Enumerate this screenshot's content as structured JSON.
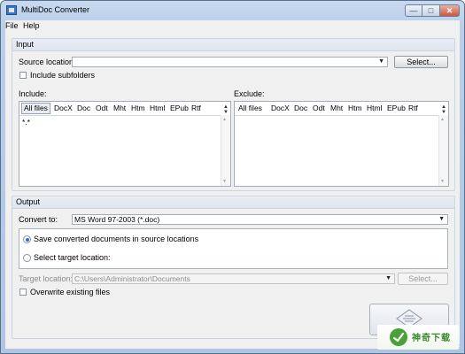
{
  "window": {
    "title": "MultiDoc Converter"
  },
  "menu": [
    "File",
    "Help"
  ],
  "input": {
    "group_title": "Input",
    "source_label": "Source location:",
    "source_value": "",
    "select_button": "Select...",
    "include_subfolders_label": "Include subfolders",
    "include_subfolders_checked": false,
    "include_label": "Include:",
    "exclude_label": "Exclude:",
    "file_types": [
      "All files",
      "DocX",
      "Doc",
      "Odt",
      "Mht",
      "Htm",
      "Html",
      "EPub",
      "Rtf"
    ],
    "include_entries": [
      "*.*"
    ],
    "exclude_entries": []
  },
  "output": {
    "group_title": "Output",
    "convert_to_label": "Convert to:",
    "convert_to_value": "MS Word 97-2003 (*.doc)",
    "save_in_source_label": "Save converted documents in source locations",
    "select_target_label": "Select target location:",
    "selected_option": "save_in_source",
    "target_location_label": "Target location:",
    "target_location_value": "C:\\Users\\Administrator\\Documents",
    "target_select_button": "Select...",
    "overwrite_label": "Overwrite existing files",
    "overwrite_checked": false
  },
  "watermark": {
    "text": "神奇下载"
  },
  "colors": {
    "window_frame": "#b9cfe9",
    "client_bg": "#f0f0f0",
    "radio_dot": "#2f6ed1",
    "watermark_green": "#3c8a2e"
  },
  "icons": [
    "app-icon",
    "minimize-icon",
    "maximize-icon",
    "close-icon",
    "dropdown-arrow-icon",
    "convert-icon",
    "watermark-logo-icon"
  ]
}
